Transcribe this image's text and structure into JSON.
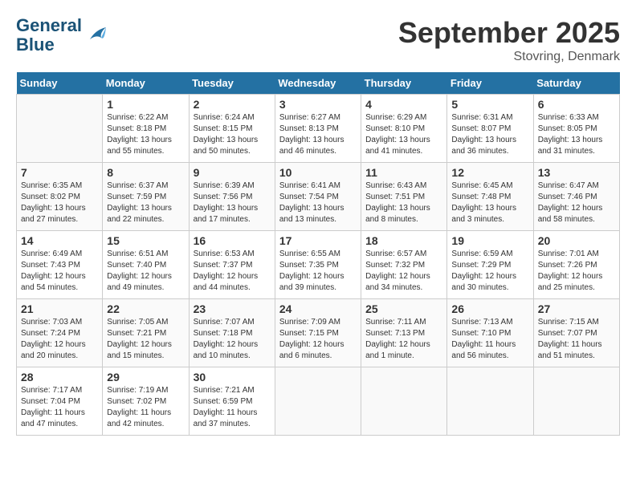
{
  "header": {
    "logo_line1": "General",
    "logo_line2": "Blue",
    "month": "September 2025",
    "location": "Stovring, Denmark"
  },
  "weekdays": [
    "Sunday",
    "Monday",
    "Tuesday",
    "Wednesday",
    "Thursday",
    "Friday",
    "Saturday"
  ],
  "weeks": [
    [
      {
        "day": "",
        "sunrise": "",
        "sunset": "",
        "daylight": ""
      },
      {
        "day": "1",
        "sunrise": "Sunrise: 6:22 AM",
        "sunset": "Sunset: 8:18 PM",
        "daylight": "Daylight: 13 hours and 55 minutes."
      },
      {
        "day": "2",
        "sunrise": "Sunrise: 6:24 AM",
        "sunset": "Sunset: 8:15 PM",
        "daylight": "Daylight: 13 hours and 50 minutes."
      },
      {
        "day": "3",
        "sunrise": "Sunrise: 6:27 AM",
        "sunset": "Sunset: 8:13 PM",
        "daylight": "Daylight: 13 hours and 46 minutes."
      },
      {
        "day": "4",
        "sunrise": "Sunrise: 6:29 AM",
        "sunset": "Sunset: 8:10 PM",
        "daylight": "Daylight: 13 hours and 41 minutes."
      },
      {
        "day": "5",
        "sunrise": "Sunrise: 6:31 AM",
        "sunset": "Sunset: 8:07 PM",
        "daylight": "Daylight: 13 hours and 36 minutes."
      },
      {
        "day": "6",
        "sunrise": "Sunrise: 6:33 AM",
        "sunset": "Sunset: 8:05 PM",
        "daylight": "Daylight: 13 hours and 31 minutes."
      }
    ],
    [
      {
        "day": "7",
        "sunrise": "Sunrise: 6:35 AM",
        "sunset": "Sunset: 8:02 PM",
        "daylight": "Daylight: 13 hours and 27 minutes."
      },
      {
        "day": "8",
        "sunrise": "Sunrise: 6:37 AM",
        "sunset": "Sunset: 7:59 PM",
        "daylight": "Daylight: 13 hours and 22 minutes."
      },
      {
        "day": "9",
        "sunrise": "Sunrise: 6:39 AM",
        "sunset": "Sunset: 7:56 PM",
        "daylight": "Daylight: 13 hours and 17 minutes."
      },
      {
        "day": "10",
        "sunrise": "Sunrise: 6:41 AM",
        "sunset": "Sunset: 7:54 PM",
        "daylight": "Daylight: 13 hours and 13 minutes."
      },
      {
        "day": "11",
        "sunrise": "Sunrise: 6:43 AM",
        "sunset": "Sunset: 7:51 PM",
        "daylight": "Daylight: 13 hours and 8 minutes."
      },
      {
        "day": "12",
        "sunrise": "Sunrise: 6:45 AM",
        "sunset": "Sunset: 7:48 PM",
        "daylight": "Daylight: 13 hours and 3 minutes."
      },
      {
        "day": "13",
        "sunrise": "Sunrise: 6:47 AM",
        "sunset": "Sunset: 7:46 PM",
        "daylight": "Daylight: 12 hours and 58 minutes."
      }
    ],
    [
      {
        "day": "14",
        "sunrise": "Sunrise: 6:49 AM",
        "sunset": "Sunset: 7:43 PM",
        "daylight": "Daylight: 12 hours and 54 minutes."
      },
      {
        "day": "15",
        "sunrise": "Sunrise: 6:51 AM",
        "sunset": "Sunset: 7:40 PM",
        "daylight": "Daylight: 12 hours and 49 minutes."
      },
      {
        "day": "16",
        "sunrise": "Sunrise: 6:53 AM",
        "sunset": "Sunset: 7:37 PM",
        "daylight": "Daylight: 12 hours and 44 minutes."
      },
      {
        "day": "17",
        "sunrise": "Sunrise: 6:55 AM",
        "sunset": "Sunset: 7:35 PM",
        "daylight": "Daylight: 12 hours and 39 minutes."
      },
      {
        "day": "18",
        "sunrise": "Sunrise: 6:57 AM",
        "sunset": "Sunset: 7:32 PM",
        "daylight": "Daylight: 12 hours and 34 minutes."
      },
      {
        "day": "19",
        "sunrise": "Sunrise: 6:59 AM",
        "sunset": "Sunset: 7:29 PM",
        "daylight": "Daylight: 12 hours and 30 minutes."
      },
      {
        "day": "20",
        "sunrise": "Sunrise: 7:01 AM",
        "sunset": "Sunset: 7:26 PM",
        "daylight": "Daylight: 12 hours and 25 minutes."
      }
    ],
    [
      {
        "day": "21",
        "sunrise": "Sunrise: 7:03 AM",
        "sunset": "Sunset: 7:24 PM",
        "daylight": "Daylight: 12 hours and 20 minutes."
      },
      {
        "day": "22",
        "sunrise": "Sunrise: 7:05 AM",
        "sunset": "Sunset: 7:21 PM",
        "daylight": "Daylight: 12 hours and 15 minutes."
      },
      {
        "day": "23",
        "sunrise": "Sunrise: 7:07 AM",
        "sunset": "Sunset: 7:18 PM",
        "daylight": "Daylight: 12 hours and 10 minutes."
      },
      {
        "day": "24",
        "sunrise": "Sunrise: 7:09 AM",
        "sunset": "Sunset: 7:15 PM",
        "daylight": "Daylight: 12 hours and 6 minutes."
      },
      {
        "day": "25",
        "sunrise": "Sunrise: 7:11 AM",
        "sunset": "Sunset: 7:13 PM",
        "daylight": "Daylight: 12 hours and 1 minute."
      },
      {
        "day": "26",
        "sunrise": "Sunrise: 7:13 AM",
        "sunset": "Sunset: 7:10 PM",
        "daylight": "Daylight: 11 hours and 56 minutes."
      },
      {
        "day": "27",
        "sunrise": "Sunrise: 7:15 AM",
        "sunset": "Sunset: 7:07 PM",
        "daylight": "Daylight: 11 hours and 51 minutes."
      }
    ],
    [
      {
        "day": "28",
        "sunrise": "Sunrise: 7:17 AM",
        "sunset": "Sunset: 7:04 PM",
        "daylight": "Daylight: 11 hours and 47 minutes."
      },
      {
        "day": "29",
        "sunrise": "Sunrise: 7:19 AM",
        "sunset": "Sunset: 7:02 PM",
        "daylight": "Daylight: 11 hours and 42 minutes."
      },
      {
        "day": "30",
        "sunrise": "Sunrise: 7:21 AM",
        "sunset": "Sunset: 6:59 PM",
        "daylight": "Daylight: 11 hours and 37 minutes."
      },
      {
        "day": "",
        "sunrise": "",
        "sunset": "",
        "daylight": ""
      },
      {
        "day": "",
        "sunrise": "",
        "sunset": "",
        "daylight": ""
      },
      {
        "day": "",
        "sunrise": "",
        "sunset": "",
        "daylight": ""
      },
      {
        "day": "",
        "sunrise": "",
        "sunset": "",
        "daylight": ""
      }
    ]
  ]
}
